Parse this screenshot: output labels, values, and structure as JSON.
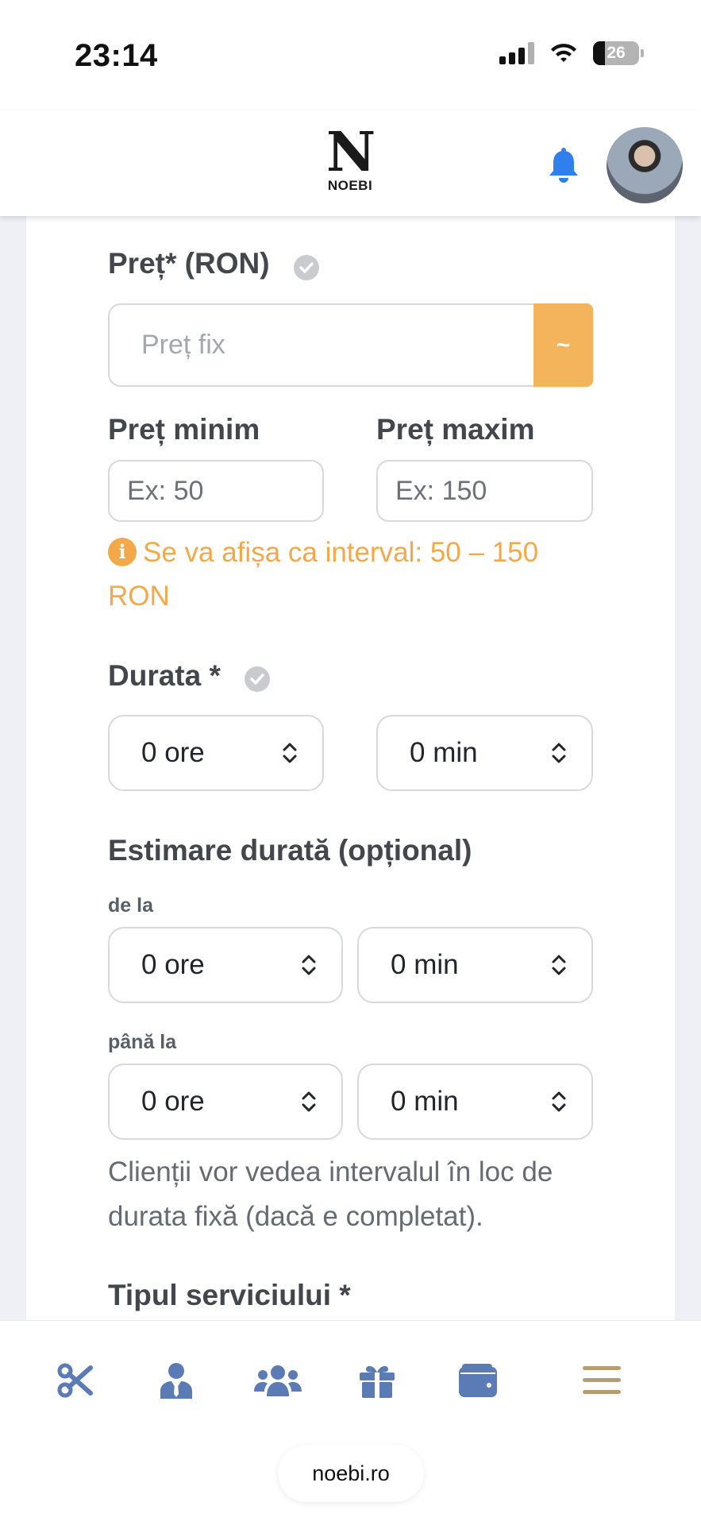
{
  "status_bar": {
    "time": "23:14",
    "battery": "26"
  },
  "header": {
    "logo_text": "NOEBI",
    "logo_mark": "N"
  },
  "form": {
    "price_label": "Preț* (RON)",
    "fixed_price_placeholder": "Preț fix",
    "range_toggle_label": "~",
    "min_price_label": "Preț minim",
    "min_price_placeholder": "Ex: 50",
    "max_price_label": "Preț maxim",
    "max_price_placeholder": "Ex: 150",
    "interval_hint": "Se va afișa ca interval: 50 – 150 RON",
    "duration_label": "Durata *",
    "duration_hours": "0 ore",
    "duration_minutes": "0 min",
    "estimate_label": "Estimare durată (opțional)",
    "from_label": "de la",
    "from_hours": "0 ore",
    "from_minutes": "0 min",
    "to_label": "până la",
    "to_hours": "0 ore",
    "to_minutes": "0 min",
    "estimate_note": "Clienții vor vedea intervalul în loc de durata fixă (dacă e completat).",
    "service_type_label": "Tipul serviciului *"
  },
  "bottom_nav": {
    "items": [
      {
        "icon": "scissors-icon",
        "color": "#5b7bb5"
      },
      {
        "icon": "user-tie-icon",
        "color": "#5b7bb5"
      },
      {
        "icon": "users-icon",
        "color": "#5b7bb5"
      },
      {
        "icon": "gift-icon",
        "color": "#5b7bb5"
      },
      {
        "icon": "wallet-icon",
        "color": "#5b7bb5"
      },
      {
        "icon": "menu-icon",
        "color": "#b99d72"
      }
    ],
    "url": "noebi.ro"
  },
  "colors": {
    "accent_orange": "#f3b45b",
    "bell_blue": "#2f80ed",
    "nav_blue": "#5b7bb5"
  }
}
